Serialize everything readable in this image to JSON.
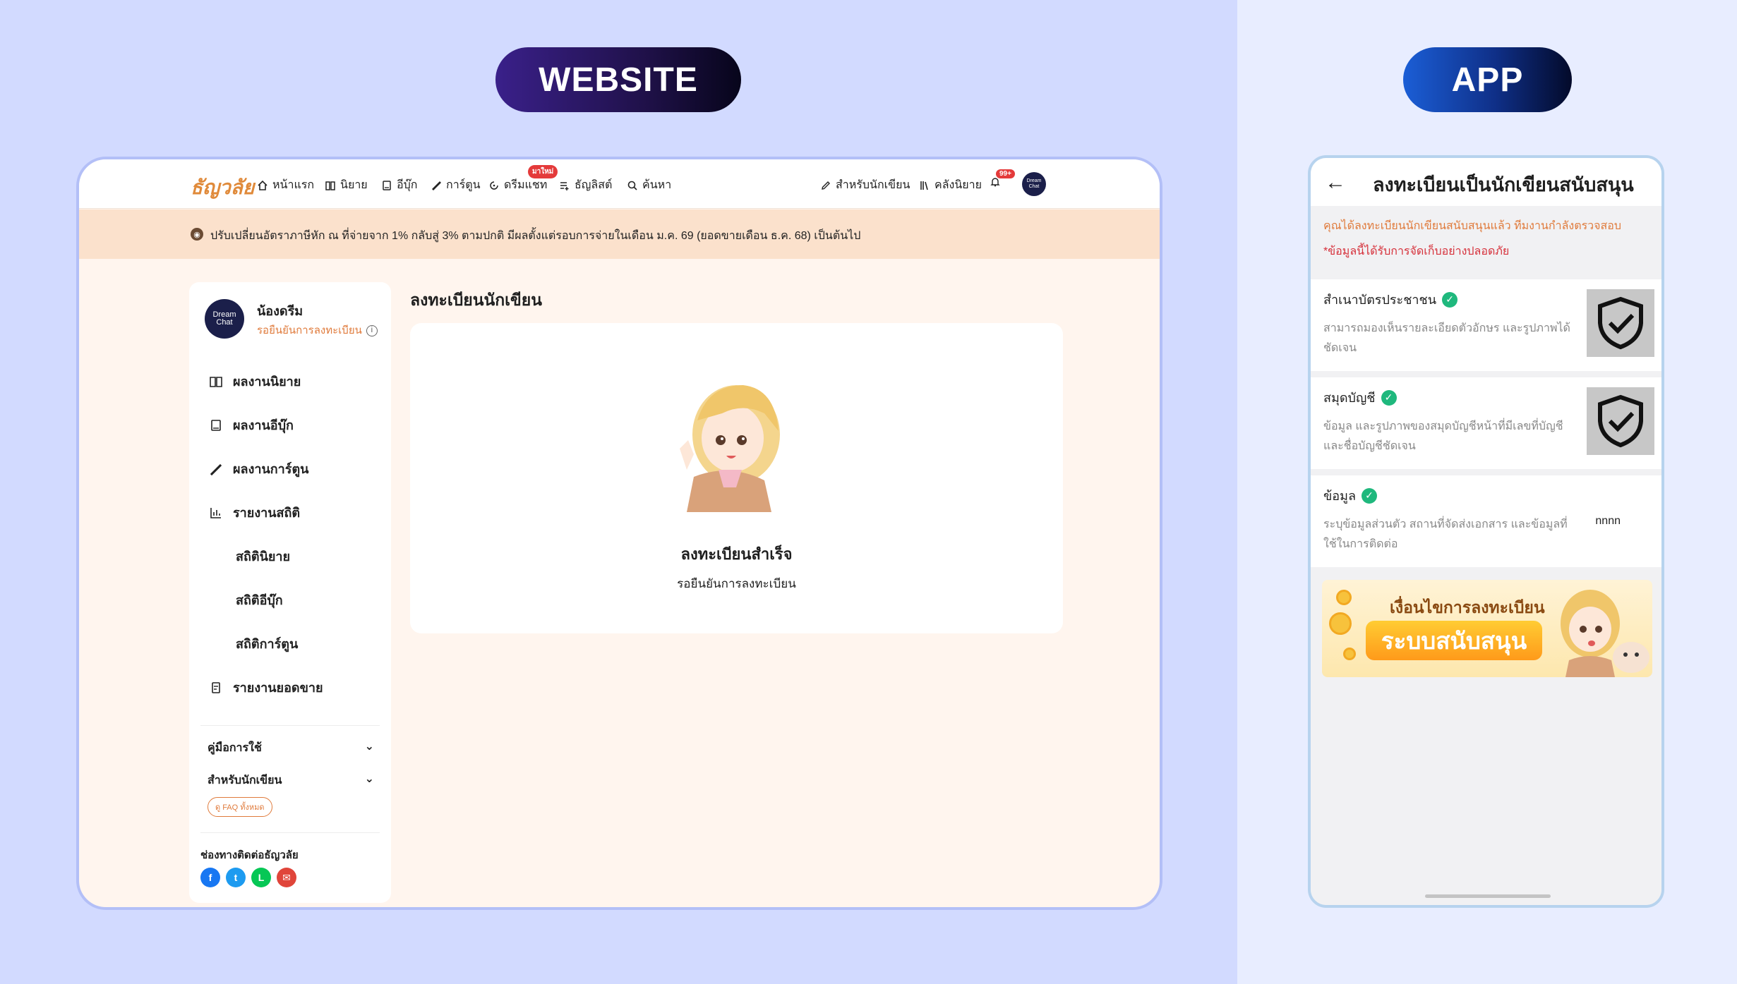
{
  "labels": {
    "website": "WEBSITE",
    "app": "APP"
  },
  "web": {
    "logo": "ธัญวลัย",
    "nav": {
      "home": "หน้าแรก",
      "novel": "นิยาย",
      "ebook": "อีบุ๊ก",
      "cartoon": "การ์ตูน",
      "dreamchat": "ดรีมแชท",
      "new_badge": "มาใหม่",
      "tanyalist": "ธัญลิสต์",
      "search": "ค้นหา",
      "for_writer": "สำหรับนักเขียน",
      "library": "คลังนิยาย",
      "notif_badge": "99+",
      "avatar_text": "Dream Chat"
    },
    "announcement": "ปรับเปลี่ยนอัตราภาษีหัก ณ ที่จ่ายจาก 1% กลับสู่ 3% ตามปกติ มีผลตั้งแต่รอบการจ่ายในเดือน ม.ค. 69 (ยอดขายเดือน ธ.ค. 68) เป็นต้นไป",
    "sidebar": {
      "avatar_text": "Dream Chat",
      "name": "น้องดรีม",
      "status": "รอยืนยันการลงทะเบียน",
      "items": [
        {
          "label": "ผลงานนิยาย"
        },
        {
          "label": "ผลงานอีบุ๊ก"
        },
        {
          "label": "ผลงานการ์ตูน"
        },
        {
          "label": "รายงานสถิติ"
        }
      ],
      "sub_items": [
        {
          "label": "สถิตินิยาย"
        },
        {
          "label": "สถิติอีบุ๊ก"
        },
        {
          "label": "สถิติการ์ตูน"
        }
      ],
      "sales_report": "รายงานยอดขาย",
      "manual": "คู่มือการใช้",
      "for_writer": "สำหรับนักเขียน",
      "faq": "ดู FAQ ทั้งหมด",
      "contact": "ช่องทางติดต่อธัญวลัย"
    },
    "page_title": "ลงทะเบียนนักเขียน",
    "card": {
      "title": "ลงทะเบียนสำเร็จ",
      "subtitle": "รอยืนยันการลงทะเบียน"
    }
  },
  "app": {
    "title": "ลงทะเบียนเป็นนักเขียนสนับสนุน",
    "notice_orange": "คุณได้ลงทะเบียนนักเขียนสนับสนุนแล้ว ทีมงานกำลังตรวจสอบ",
    "notice_red": "*ข้อมูลนี้ได้รับการจัดเก็บอย่างปลอดภัย",
    "rows": [
      {
        "title": "สำเนาบัตรประชาชน",
        "desc": "สามารถมองเห็นรายละเอียดตัวอักษร และรูปภาพได้ชัดเจน"
      },
      {
        "title": "สมุดบัญชี",
        "desc": "ข้อมูล และรูปภาพของสมุดบัญชีหน้าที่มีเลขที่บัญชีและชื่อบัญชีชัดเจน"
      },
      {
        "title": "ข้อมูล",
        "desc": "ระบุข้อมูลส่วนตัว สถานที่จัดส่งเอกสาร และข้อมูลที่ใช้ในการติดต่อ",
        "value": "nnnn"
      }
    ],
    "banner": {
      "line1": "เงื่อนไขการลงทะเบียน",
      "line2": "ระบบสนับสนุน"
    }
  },
  "colors": {
    "accent": "#e07b3c",
    "success": "#1fb87d",
    "alert": "#d6303a",
    "announce_bg": "#fbe1cc"
  }
}
